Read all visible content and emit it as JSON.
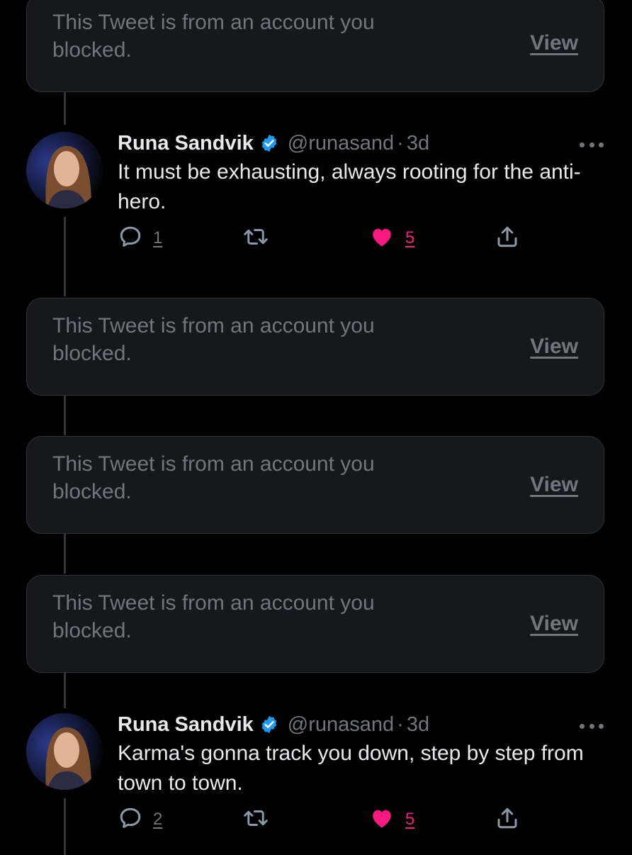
{
  "colors": {
    "background": "#000000",
    "card": "#16181c",
    "muted": "#71767b",
    "text": "#e7e9ea",
    "like": "#f91880",
    "verified": "#1d9bf0"
  },
  "blocked_label": "This Tweet is from an account you blocked.",
  "view_label": "View",
  "tweets": [
    {
      "name": "Runa Sandvik",
      "verified": true,
      "handle": "@runasand",
      "separator": "·",
      "time": "3d",
      "text": "It must be exhausting, always rooting for the anti-hero.",
      "reply_count": "1",
      "like_count": "5",
      "liked": true,
      "icons": [
        "reply-icon",
        "retweet-icon",
        "heart-icon",
        "share-icon",
        "more-icon"
      ]
    },
    {
      "name": "Runa Sandvik",
      "verified": true,
      "handle": "@runasand",
      "separator": "·",
      "time": "3d",
      "text": "Karma's gonna track you down, step by step from town to town.",
      "reply_count": "2",
      "like_count": "5",
      "liked": true,
      "icons": [
        "reply-icon",
        "retweet-icon",
        "heart-icon",
        "share-icon",
        "more-icon"
      ]
    }
  ]
}
